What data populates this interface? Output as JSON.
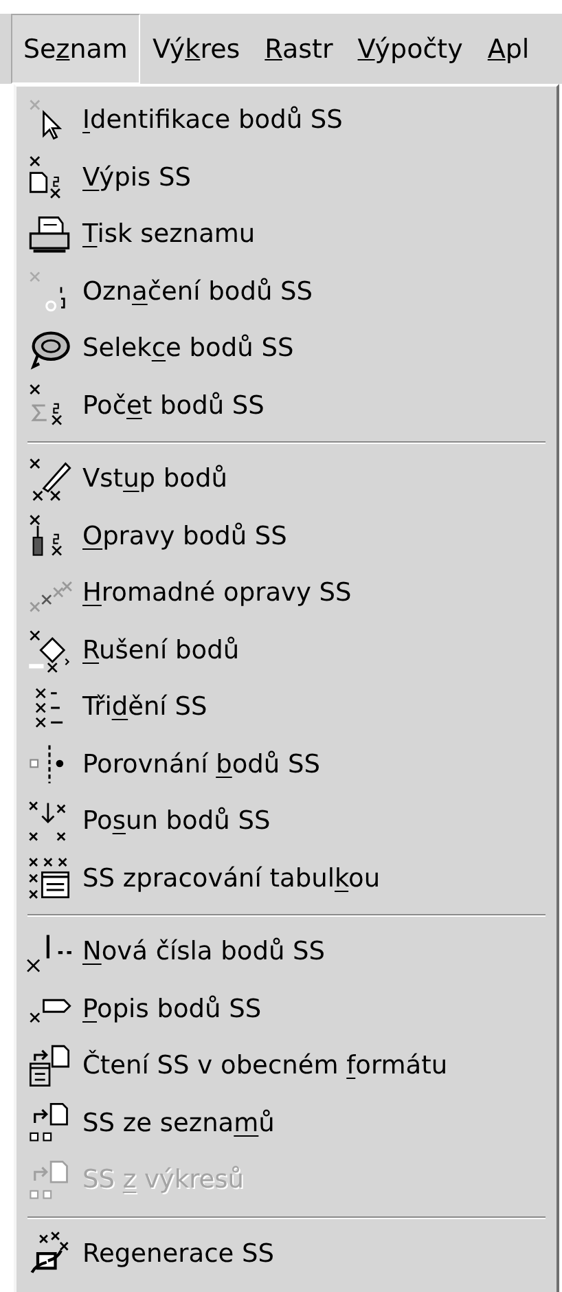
{
  "menubar": [
    {
      "label": {
        "pre": "Se",
        "key": "z",
        "post": "nam"
      },
      "selected": true
    },
    {
      "label": {
        "pre": "Vý",
        "key": "k",
        "post": "res"
      },
      "selected": false
    },
    {
      "label": {
        "key": "R",
        "post": "astr"
      },
      "selected": false
    },
    {
      "label": {
        "key": "V",
        "post": "ýpočty"
      },
      "selected": false
    },
    {
      "label": {
        "key": "A",
        "post": "pl"
      },
      "selected": false
    }
  ],
  "menu": {
    "sections": [
      {
        "items": [
          {
            "label": {
              "key": "I",
              "post": "dentifikace bodů SS"
            },
            "disabled": false
          },
          {
            "label": {
              "key": "V",
              "post": "ýpis SS"
            },
            "disabled": false
          },
          {
            "label": {
              "key": "T",
              "post": "isk seznamu"
            },
            "disabled": false
          },
          {
            "label": {
              "pre": "Ozn",
              "key": "a",
              "post": "čení bodů SS"
            },
            "disabled": false
          },
          {
            "label": {
              "pre": "Selek",
              "key": "c",
              "post": "e bodů SS"
            },
            "disabled": false
          },
          {
            "label": {
              "pre": "Poč",
              "key": "e",
              "post": "t bodů SS"
            },
            "disabled": false
          }
        ]
      },
      {
        "items": [
          {
            "label": {
              "pre": "Vst",
              "key": "u",
              "post": "p bodů"
            },
            "disabled": false
          },
          {
            "label": {
              "key": "O",
              "post": "pravy bodů SS"
            },
            "disabled": false
          },
          {
            "label": {
              "key": "H",
              "post": "romadné opravy SS"
            },
            "disabled": false
          },
          {
            "label": {
              "key": "R",
              "post": "ušení bodů"
            },
            "disabled": false
          },
          {
            "label": {
              "pre": "Tři",
              "key": "d",
              "post": "ění SS"
            },
            "disabled": false
          },
          {
            "label": {
              "pre": "Porovnání ",
              "key": "b",
              "post": "odů SS"
            },
            "disabled": false
          },
          {
            "label": {
              "pre": "Po",
              "key": "s",
              "post": "un bodů SS"
            },
            "disabled": false
          },
          {
            "label": {
              "pre": "SS zpracování tabul",
              "key": "k",
              "post": "ou"
            },
            "disabled": false
          }
        ]
      },
      {
        "items": [
          {
            "label": {
              "key": "N",
              "post": "ová čísla bodů SS"
            },
            "disabled": false
          },
          {
            "label": {
              "key": "P",
              "post": "opis bodů SS"
            },
            "disabled": false
          },
          {
            "label": {
              "pre": "Čtení SS v obecném ",
              "key": "f",
              "post": "ormátu"
            },
            "disabled": false
          },
          {
            "label": {
              "pre": "SS ze sezna",
              "key": "m",
              "post": "ů"
            },
            "disabled": false
          },
          {
            "label": {
              "pre": "SS ",
              "key": "z",
              "post": " výkresů"
            },
            "disabled": true
          }
        ]
      },
      {
        "items": [
          {
            "label": {
              "pre": "Regenerace SS"
            },
            "disabled": false
          }
        ]
      }
    ]
  }
}
